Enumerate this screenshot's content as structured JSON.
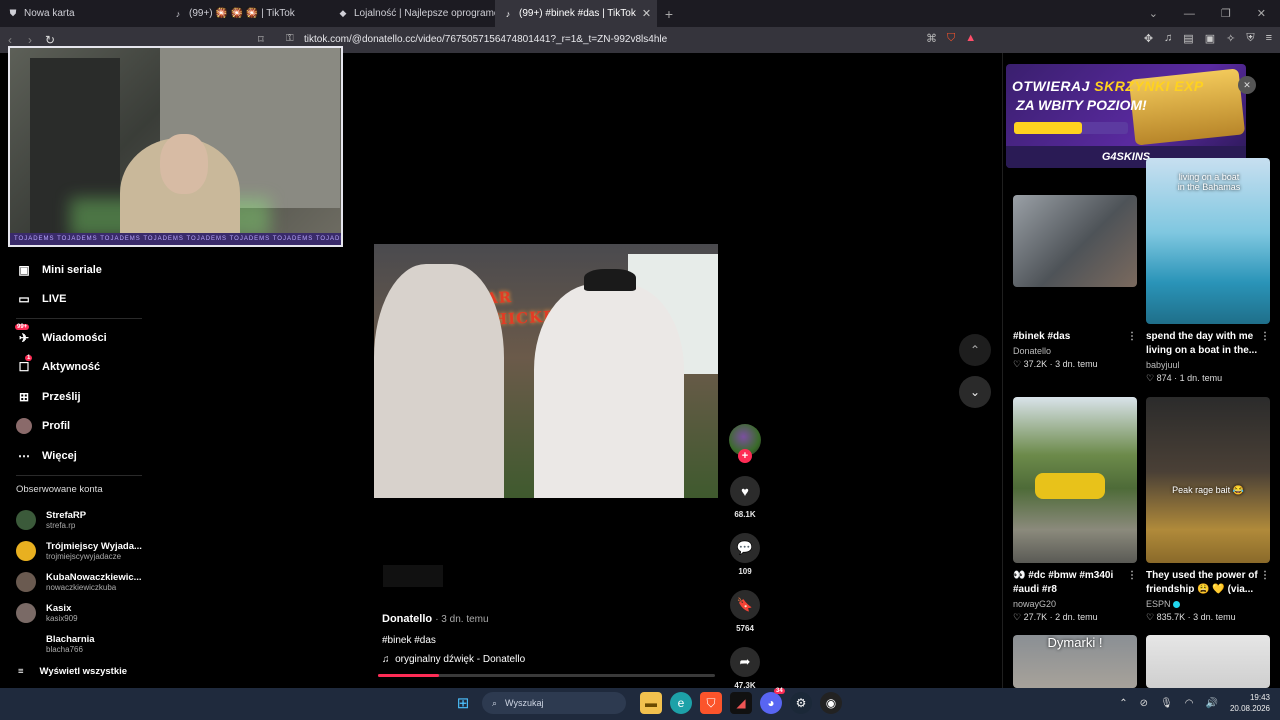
{
  "browser": {
    "tabs": [
      {
        "title": "Nowa karta",
        "icon": "browser-icon"
      },
      {
        "title": "(99+) 🎇 🎇 🎇 | TikTok",
        "icon": "tiktok-icon"
      },
      {
        "title": "Lojalność | Najlepsze oprogramowan",
        "icon": "diamond-icon"
      },
      {
        "title": "(99+) #binek #das | TikTok",
        "icon": "tiktok-icon",
        "close": "✕"
      }
    ],
    "new_tab": "+",
    "url": "tiktok.com/@donatello.cc/video/7675057156474801441?_r=1&_t=ZN-992v8ls4hle"
  },
  "webcam": {
    "strip": "TOJADEMS TOJADEMS TOJADEMS TOJADEMS TOJADEMS TOJADEMS TOJADEMS TOJADEMS"
  },
  "sidebar": {
    "nav": [
      {
        "label": "Mini seriale",
        "icon": "film-icon",
        "glyph": "▣"
      },
      {
        "label": "LIVE",
        "icon": "live-icon",
        "glyph": "▭"
      },
      {
        "label": "Wiadomości",
        "icon": "message-icon",
        "glyph": "✈",
        "badge": "99+"
      },
      {
        "label": "Aktywność",
        "icon": "activity-icon",
        "glyph": "☐",
        "badge": "1"
      },
      {
        "label": "Prześlij",
        "icon": "upload-icon",
        "glyph": "⊞"
      },
      {
        "label": "Profil",
        "icon": "profile-avatar",
        "glyph": "●"
      },
      {
        "label": "Więcej",
        "icon": "more-icon",
        "glyph": "⋯"
      }
    ],
    "following_title": "Obserwowane konta",
    "accounts": [
      {
        "name": "StrefaRP",
        "handle": "strefa.rp",
        "color": "#3b5a3a"
      },
      {
        "name": "Trójmiejscy Wyjada...",
        "handle": "trojmiejscywyjadacze",
        "color": "#e8b020"
      },
      {
        "name": "KubaNowaczkiewic...",
        "handle": "nowaczkiewiczkuba",
        "color": "#6a5a50"
      },
      {
        "name": "Kasix",
        "handle": "kasix909",
        "color": "#7a6a66"
      },
      {
        "name": "Blacharnia",
        "handle": "blacha766",
        "color": "#000000"
      }
    ],
    "show_all": "Wyświetl wszystkie"
  },
  "video": {
    "sign": "ŻAR",
    "sign2": "CHICKEN",
    "author": "Donatello",
    "age": "· 3 dn. temu",
    "tags": "#binek #das",
    "music_icon": "♫",
    "music": "oryginalny dźwięk - Donatello",
    "progress": 0.18
  },
  "actions": {
    "likes": "68.1K",
    "comments": "109",
    "saves": "5764",
    "shares": "47.3K"
  },
  "ad": {
    "line1_pre": "OTWIERAJ ",
    "line1_hl": "SKRZYNKI EXP",
    "line2": "ZA WBITY POZIOM!",
    "brand": "G4SKINS",
    "close": "✕",
    "level": 0.6
  },
  "recommended": [
    {
      "title": "#binek #das",
      "author": "Donatello",
      "views": "37.2K",
      "age": "3 dn. temu"
    },
    {
      "overlay": "living on a boat in the Bahamas",
      "title": "spend the day with me living on a boat in the...",
      "author": "babyjuul",
      "views": "874",
      "age": "1 dn. temu"
    },
    {
      "title": "👀 #dc #bmw #m340i #audi #r8",
      "author": "nowayG20",
      "views": "27.7K",
      "age": "2 dn. temu"
    },
    {
      "overlay": "Peak rage bait 😂",
      "title": "They used the power of friendship 😩 💛 (via...",
      "author": "ESPN",
      "views": "835.7K",
      "age": "3 dn. temu"
    },
    {
      "overlay": "Dymarki !"
    }
  ],
  "taskbar": {
    "search": "Wyszukaj",
    "time": "19:43",
    "date": "20.08.2026",
    "discord_badge": "34"
  }
}
